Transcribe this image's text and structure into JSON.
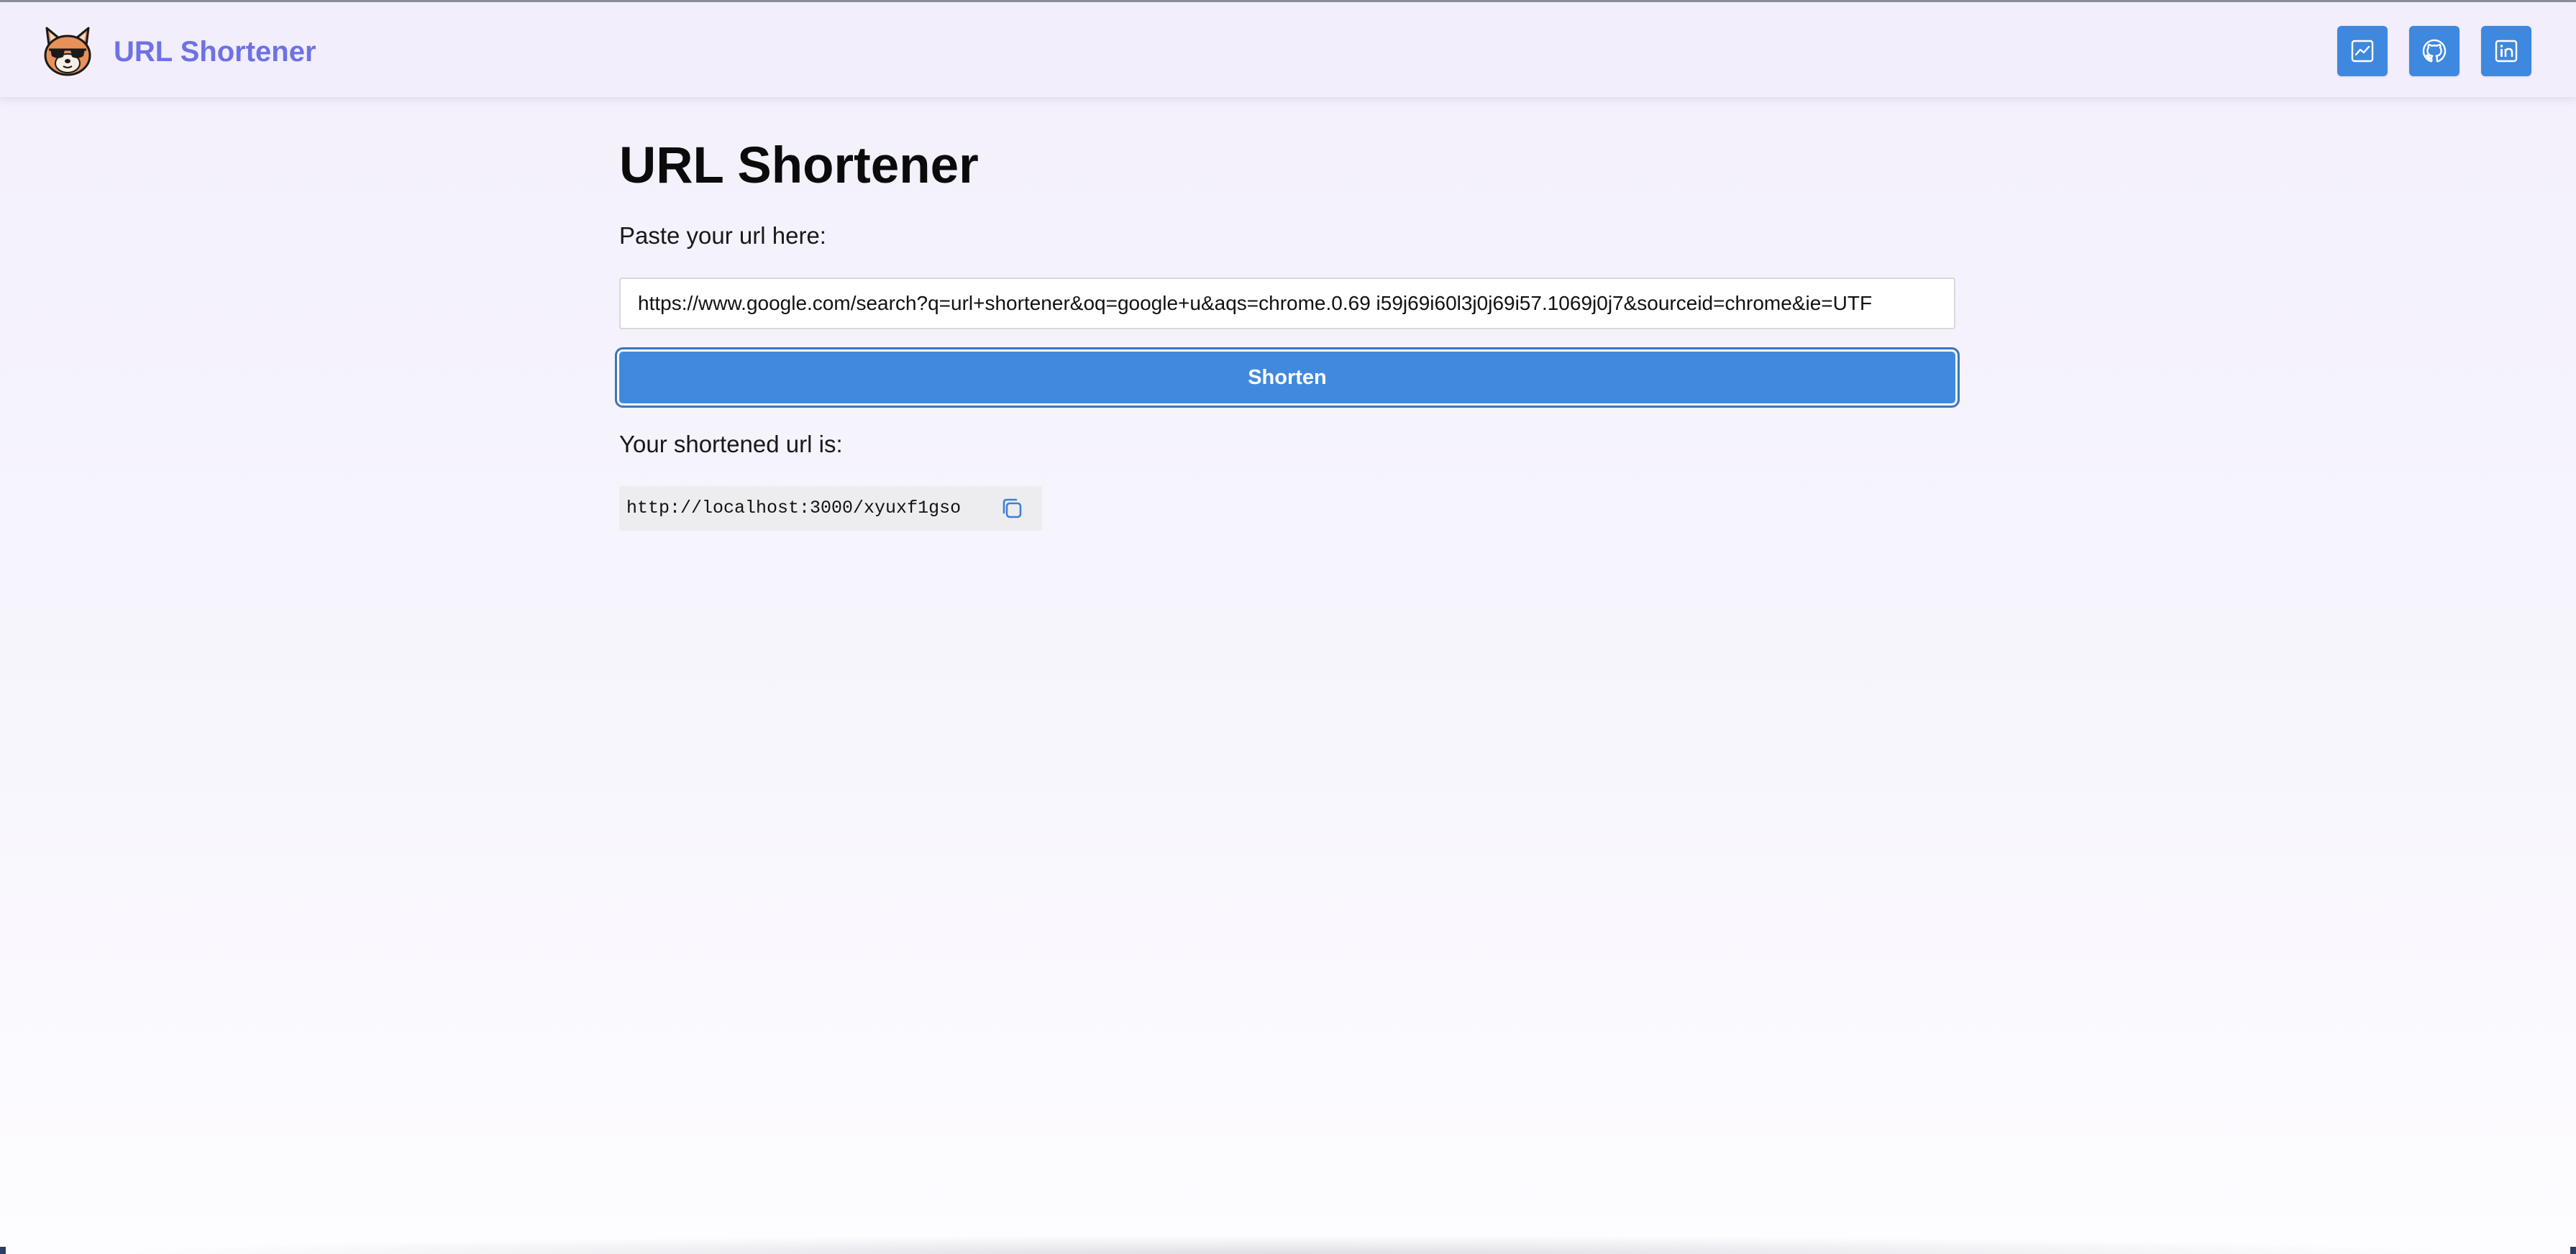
{
  "header": {
    "brand": "URL Shortener",
    "logo_icon": "shiba-sunglasses-logo-icon",
    "buttons": [
      {
        "icon": "analytics-chart-icon"
      },
      {
        "icon": "github-icon"
      },
      {
        "icon": "linkedin-icon"
      }
    ]
  },
  "main": {
    "title": "URL Shortener",
    "input_label": "Paste your url here:",
    "input_value": "https://www.google.com/search?q=url+shortener&oq=google+u&aqs=chrome.0.69 i59j69i60l3j0j69i57.1069j0j7&sourceid=chrome&ie=UTF",
    "submit_label": "Shorten",
    "result_label": "Your shortened url is:",
    "result_url": "http://localhost:3000/xyuxf1gso",
    "copy_icon": "copy-icon"
  },
  "colors": {
    "accent": "#4189de",
    "brand": "#6e72e6",
    "header_bg": "#f2eefb",
    "page_bg": "#f5f3fc"
  }
}
